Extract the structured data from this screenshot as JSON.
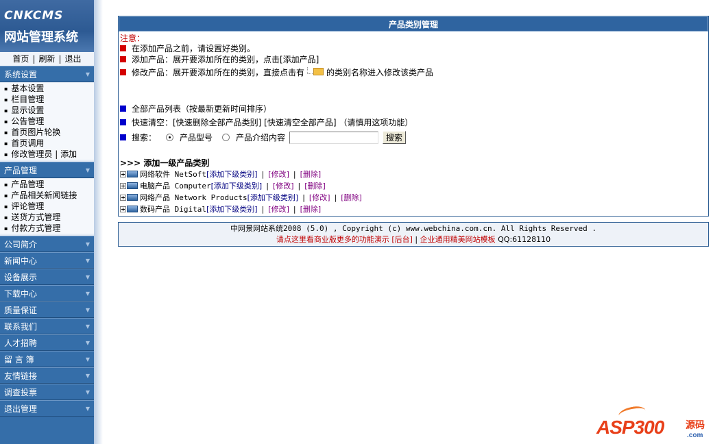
{
  "logo": {
    "line1": "CNKCMS",
    "line2": "网站管理系统"
  },
  "toplinks": {
    "home": "首页",
    "refresh": "刷新",
    "logout": "退出"
  },
  "sidebar": {
    "system_settings": "系统设置",
    "system_items": [
      "基本设置",
      "栏目管理",
      "显示设置",
      "公告管理",
      "首页图片轮换",
      "首页调用",
      "修改管理员 | 添加"
    ],
    "product_mgmt": "产品管理",
    "product_items": [
      "产品管理",
      "产品相关新闻链接",
      "评论管理",
      "送货方式管理",
      "付款方式管理"
    ],
    "sections": [
      "公司简介",
      "新闻中心",
      "设备展示",
      "下载中心",
      "质量保证",
      "联系我们",
      "人才招聘",
      "留 言 簿",
      "友情链接",
      "调查投票",
      "退出管理"
    ]
  },
  "panel": {
    "title": "产品类别管理",
    "notice": "注意：",
    "tips": [
      "在添加产品之前，请设置好类别。",
      "添加产品：展开要添加所在的类别，点击[添加产品]",
      "修改产品：展开要添加所在的类别，直接点击有",
      "的类别名称进入修改该类产品"
    ],
    "all_products": "全部产品列表（按最新更新时间排序）",
    "quick_clear": "快速清空：[快速删除全部产品类别] [快速清空全部产品] （请慎用这项功能）",
    "search_label": "搜索：",
    "radio_model": "产品型号",
    "radio_intro": "产品介绍内容",
    "search_button": "搜索",
    "add_heading": ">>> 添加一级产品类别",
    "categories": [
      {
        "name": "网络软件 NetSoft",
        "add": "[添加下级类别]",
        "edit": "[修改]",
        "del": "[删除]"
      },
      {
        "name": "电脑产品 Computer",
        "add": "[添加下级类别]",
        "edit": "[修改]",
        "del": "[删除]"
      },
      {
        "name": "网络产品 Network Products",
        "add": "[添加下级类别]",
        "edit": "[修改]",
        "del": "[删除]"
      },
      {
        "name": "数码产品 Digital",
        "add": "[添加下级类别]",
        "edit": "[修改]",
        "del": "[删除]"
      }
    ]
  },
  "footer": {
    "copyright": "中网景网站系统2008 (5.0) , Copyright (c) www.webchina.com.cn. All Rights Reserved .",
    "promo": "请点这里看商业版更多的功能演示",
    "backend": "[后台]",
    "sep": "|",
    "templates": "企业通用精美网站模板",
    "qq": "QQ:61128110"
  },
  "watermark": {
    "brand": "ASP300",
    "cn": "源码",
    "domain": ".com"
  }
}
